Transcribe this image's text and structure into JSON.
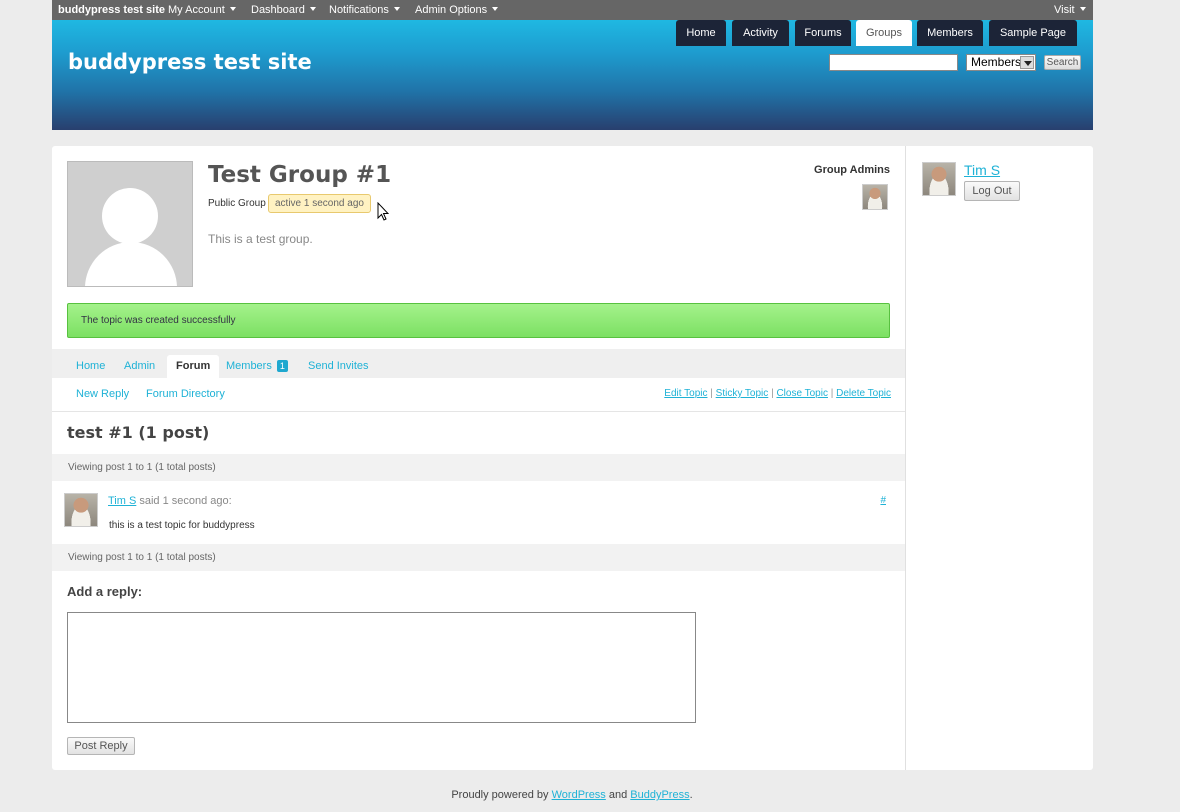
{
  "adminbar": {
    "site_name": "buddypress test site",
    "menus": [
      "My Account",
      "Dashboard",
      "Notifications",
      "Admin Options"
    ],
    "visit": "Visit"
  },
  "header": {
    "site_title": "buddypress test site",
    "search": {
      "select_value": "Members",
      "button": "Search"
    },
    "nav": [
      "Home",
      "Activity",
      "Forums",
      "Groups",
      "Members",
      "Sample Page"
    ],
    "nav_active": "Groups"
  },
  "group": {
    "title": "Test Group #1",
    "type": "Public Group",
    "activity": "active 1 second ago",
    "description": "This is a test group.",
    "admins_label": "Group Admins"
  },
  "notice": "The topic was created successfully",
  "subnav": {
    "tabs": [
      "Home",
      "Admin",
      "Forum",
      "Members",
      "Send Invites"
    ],
    "active": "Forum",
    "members_count": "1"
  },
  "forum": {
    "new_reply": "New Reply",
    "forum_directory": "Forum Directory",
    "actions": [
      "Edit Topic",
      "Sticky Topic",
      "Close Topic",
      "Delete Topic"
    ],
    "separator": "|",
    "topic_title": "test #1 (1 post)",
    "pagination": "Viewing post 1 to 1 (1 total posts)",
    "post": {
      "author": "Tim S",
      "said": "said 1 second ago:",
      "permalink": "#",
      "content": "this is a test topic for buddypress"
    },
    "reply_heading": "Add a reply:",
    "post_reply_button": "Post Reply"
  },
  "sidebar": {
    "user": "Tim S",
    "logout": "Log Out"
  },
  "footer": {
    "prefix": "Proudly powered by ",
    "wordpress": "WordPress",
    "and": " and ",
    "buddypress": "BuddyPress",
    "suffix": "."
  },
  "colors": {
    "link": "#1fb2d6",
    "header_top": "#1fb8e2",
    "header_bottom": "#283f6e",
    "nav_tab": "#1c2437",
    "notice": "#7ce063"
  }
}
